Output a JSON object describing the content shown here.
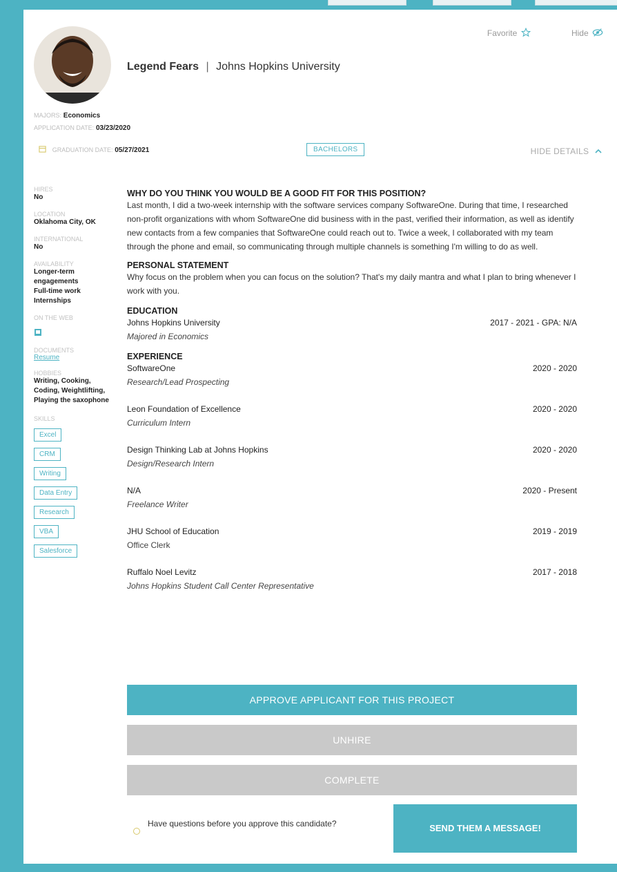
{
  "profile": {
    "name": "Legend Fears",
    "separator": "|",
    "university": "Johns Hopkins University",
    "favorite_label": "Favorite",
    "hide_label": "Hide",
    "majors_label": "MAJORS:",
    "majors_value": "Economics",
    "application_date_label": "APPLICATION DATE:",
    "application_date_value": "03/23/2020",
    "graduation_date_label": "GRADUATION DATE:",
    "graduation_date_value": "05/27/2021",
    "degree_badge": "BACHELORS",
    "hide_details_label": "HIDE DETAILS"
  },
  "sidebar": {
    "hires_label": "HIRES",
    "hires_value": "No",
    "location_label": "LOCATION",
    "location_value": "Oklahoma City, OK",
    "international_label": "INTERNATIONAL",
    "international_value": "No",
    "availability_label": "AVAILABILITY",
    "availability_items": [
      "Longer-term engagements",
      "Full-time work",
      "Internships"
    ],
    "web_label": "ON THE WEB",
    "documents_label": "DOCUMENTS",
    "resume_link": "Resume",
    "hobbies_label": "HOBBIES",
    "hobbies_value": "Writing, Cooking, Coding, Weightlifting, Playing the saxophone",
    "skills_label": "SKILLS",
    "skills": [
      "Excel",
      "CRM",
      "Writing",
      "Data Entry",
      "Research",
      "VBA",
      "Salesforce"
    ]
  },
  "main": {
    "fit_title": "WHY DO YOU THINK YOU WOULD BE A GOOD FIT FOR THIS POSITION?",
    "fit_text": "Last month, I did a two-week internship with the software services company SoftwareOne. During that time, I researched non-profit organizations with whom SoftwareOne did business with in the past, verified their information, as well as identify new contacts from a few companies that SoftwareOne could reach out to. Twice a week, I collaborated with my team through the phone and email, so communicating through multiple channels is something I'm willing to do as well.",
    "statement_title": "PERSONAL STATEMENT",
    "statement_text": "Why focus on the problem when you can focus on the solution? That's my daily mantra and what I plan to bring whenever I work with you.",
    "education_title": "EDUCATION",
    "education": {
      "school": "Johns Hopkins University",
      "dates": "2017 - 2021 - GPA: N/A",
      "major": "Majored in Economics"
    },
    "experience_title": "EXPERIENCE",
    "experience": [
      {
        "org": "SoftwareOne",
        "dates": "2020 - 2020",
        "role": "Research/Lead Prospecting"
      },
      {
        "org": "Leon Foundation of Excellence",
        "dates": "2020 - 2020",
        "role": "Curriculum Intern"
      },
      {
        "org": "Design Thinking Lab at Johns Hopkins",
        "dates": "2020 - 2020",
        "role": "Design/Research Intern"
      },
      {
        "org": "N/A",
        "dates": "2020 - Present",
        "role": "Freelance Writer"
      },
      {
        "org": "JHU School of Education",
        "dates": "2019 - 2019",
        "role": "Office Clerk"
      },
      {
        "org": "Ruffalo Noel Levitz",
        "dates": "2017 - 2018",
        "role": "Johns Hopkins Student Call Center Representative"
      }
    ]
  },
  "actions": {
    "approve": "APPROVE APPLICANT FOR THIS PROJECT",
    "unhire": "UNHIRE",
    "complete": "COMPLETE",
    "question": "Have questions before you approve this candidate?",
    "send_message": "SEND THEM A MESSAGE!"
  },
  "colors": {
    "accent": "#4db3c3",
    "disabled": "#c9c9c9"
  },
  "icons": [
    "star-icon",
    "eye-hide-icon",
    "calendar-icon",
    "chevron-up-icon",
    "web-link-icon",
    "question-bubble-icon"
  ]
}
